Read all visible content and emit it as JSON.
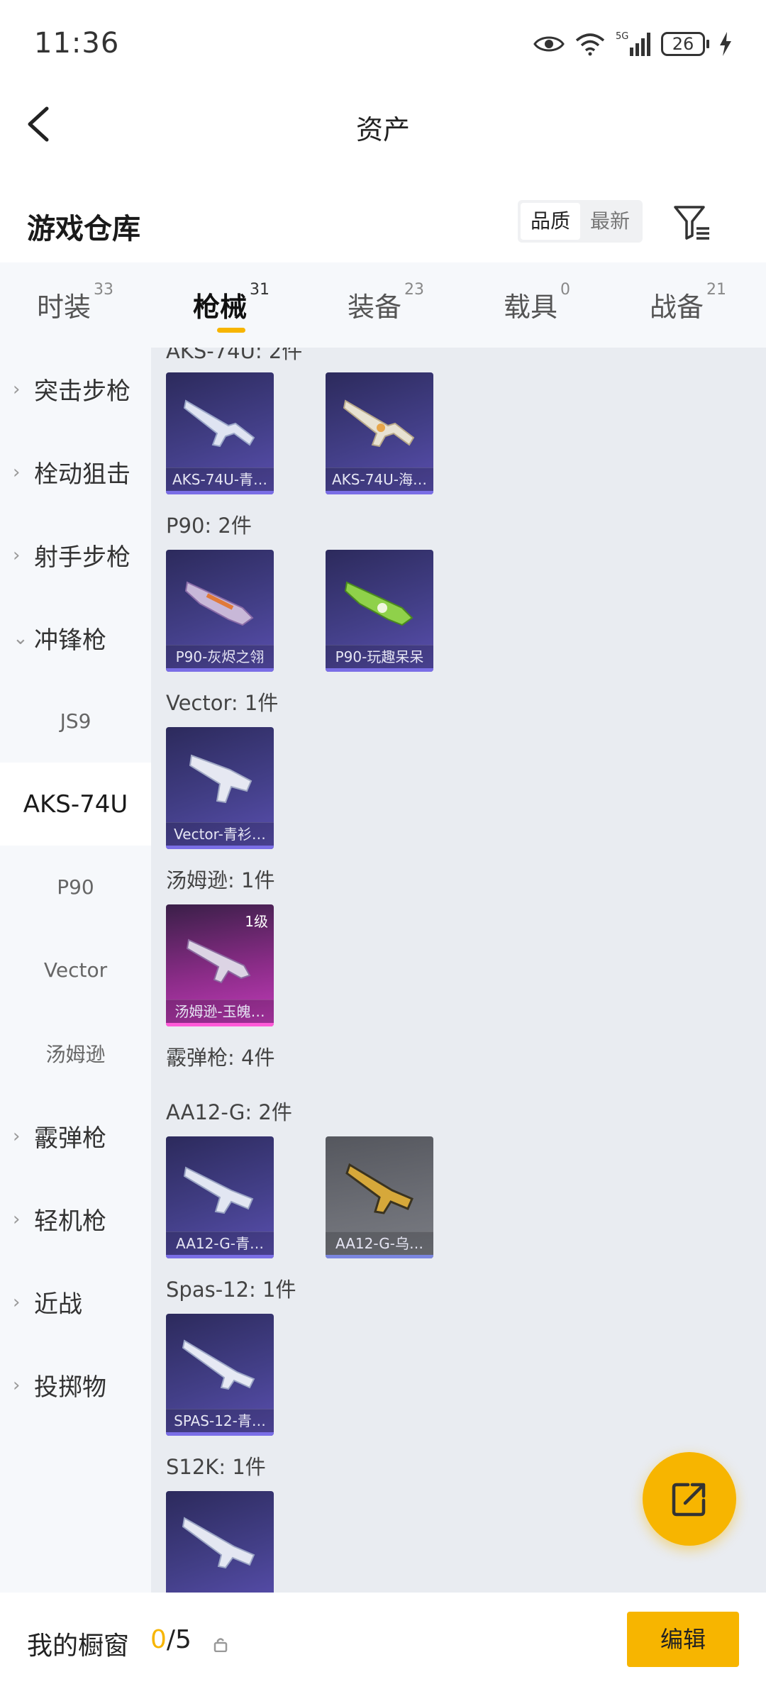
{
  "status_bar": {
    "time": "11:36",
    "battery": "26",
    "network": "5G"
  },
  "header": {
    "title": "资产"
  },
  "warehouse": {
    "title": "游戏仓库",
    "sort_options": [
      "品质",
      "最新"
    ]
  },
  "tabs": [
    {
      "label": "时装",
      "count": "33"
    },
    {
      "label": "枪械",
      "count": "31"
    },
    {
      "label": "装备",
      "count": "23"
    },
    {
      "label": "载具",
      "count": "0"
    },
    {
      "label": "战备",
      "count": "21"
    }
  ],
  "sidebar": {
    "items": [
      {
        "label": "突击步枪",
        "type": "category"
      },
      {
        "label": "栓动狙击",
        "type": "category"
      },
      {
        "label": "射手步枪",
        "type": "category"
      },
      {
        "label": "冲锋枪",
        "type": "category-open"
      },
      {
        "label": "JS9",
        "type": "sub"
      },
      {
        "label": "AKS-74U",
        "type": "sub-active"
      },
      {
        "label": "P90",
        "type": "sub"
      },
      {
        "label": "Vector",
        "type": "sub"
      },
      {
        "label": "汤姆逊",
        "type": "sub"
      },
      {
        "label": "霰弹枪",
        "type": "category"
      },
      {
        "label": "轻机枪",
        "type": "category"
      },
      {
        "label": "近战",
        "type": "category"
      },
      {
        "label": "投掷物",
        "type": "category"
      }
    ]
  },
  "content": {
    "groups": {
      "aks": {
        "label": "AKS-74U: 2件",
        "items": [
          "AKS-74U-青…",
          "AKS-74U-海…"
        ]
      },
      "p90": {
        "label": "P90: 2件",
        "items": [
          "P90-灰烬之翎",
          "P90-玩趣呆呆"
        ]
      },
      "vector": {
        "label": "Vector: 1件",
        "items": [
          "Vector-青衫…"
        ]
      },
      "thompson": {
        "label": "汤姆逊: 1件",
        "items": [
          "汤姆逊-玉魄…"
        ],
        "level": "1级"
      },
      "shotgun": {
        "label": "霰弹枪: 4件"
      },
      "aa12": {
        "label": "AA12-G: 2件",
        "items": [
          "AA12-G-青…",
          "AA12-G-乌…"
        ]
      },
      "spas": {
        "label": "Spas-12: 1件",
        "items": [
          "SPAS-12-青…"
        ]
      },
      "s12k": {
        "label": "S12K: 1件"
      }
    }
  },
  "bottom_bar": {
    "label": "我的橱窗",
    "count_current": "0",
    "count_total": "/5",
    "edit_label": "编辑"
  },
  "colors": {
    "accent": "#f7b500",
    "card_purple": "#433f88",
    "card_pink": "#c23cba",
    "card_gray": "#6d6f76"
  },
  "icons": [
    "eye-icon",
    "wifi-icon",
    "signal-icon",
    "battery-icon",
    "charging-icon",
    "back-icon",
    "filter-icon",
    "share-icon",
    "lock-icon"
  ]
}
